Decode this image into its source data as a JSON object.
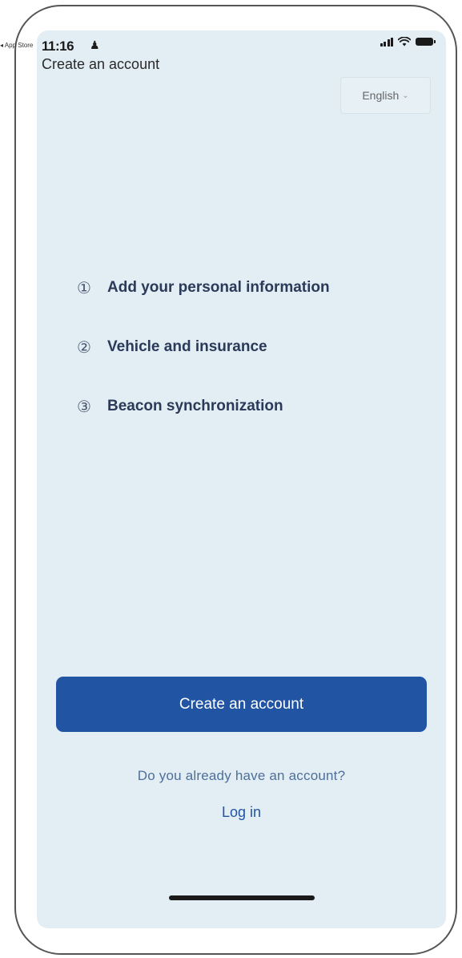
{
  "status_bar": {
    "time": "11:16",
    "back_label": "◂ App Store",
    "person_icon": "♟"
  },
  "header": {
    "title": "Create an account",
    "language": "English",
    "language_chevron": "⌵"
  },
  "steps": [
    {
      "number": "①",
      "label": "Add your personal information"
    },
    {
      "number": "②",
      "label": "Vehicle and insurance"
    },
    {
      "number": "③",
      "label": "Beacon synchronization"
    }
  ],
  "actions": {
    "create_account": "Create an account",
    "already_have_account": "Do you already have an account?",
    "login": "Log in"
  },
  "colors": {
    "screen_background": "#e2eef4",
    "primary": "#2155a3",
    "step_text": "#2a3a58"
  }
}
